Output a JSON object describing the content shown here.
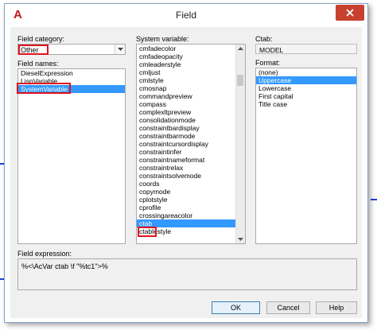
{
  "window": {
    "title": "Field",
    "logo_letter": "A"
  },
  "field_category": {
    "label": "Field category:",
    "value": "Other"
  },
  "field_names": {
    "label": "Field names:",
    "items": [
      "DieselExpression",
      "LispVariable",
      "SystemVariable"
    ],
    "selected": "SystemVariable"
  },
  "system_variable": {
    "label": "System variable:",
    "items": [
      "cmfadecolor",
      "cmfadeopacity",
      "cmleaderstyle",
      "cmljust",
      "cmlstyle",
      "cmosnap",
      "commandpreview",
      "compass",
      "complexltpreview",
      "consolidationmode",
      "constraintbardisplay",
      "constraintbarmode",
      "constraintcursordisplay",
      "constraintinfer",
      "constraintnameformat",
      "constraintrelax",
      "constraintsolvemode",
      "coords",
      "copymode",
      "cplotstyle",
      "cprofile",
      "crossingareacolor",
      "ctab",
      "ctablestyle"
    ],
    "selected": "ctab"
  },
  "ctab": {
    "label": "Ctab:",
    "value": "MODEL"
  },
  "format": {
    "label": "Format:",
    "items": [
      "(none)",
      "Uppercase",
      "Lowercase",
      "First capital",
      "Title case"
    ],
    "selected": "Uppercase"
  },
  "field_expression": {
    "label": "Field expression:",
    "value": "%<\\AcVar ctab \\f \"%tc1\">%"
  },
  "buttons": {
    "ok": "OK",
    "cancel": "Cancel",
    "help": "Help"
  },
  "colors": {
    "selection": "#3399ff",
    "highlight": "#e0141e",
    "close": "#c8412e"
  }
}
